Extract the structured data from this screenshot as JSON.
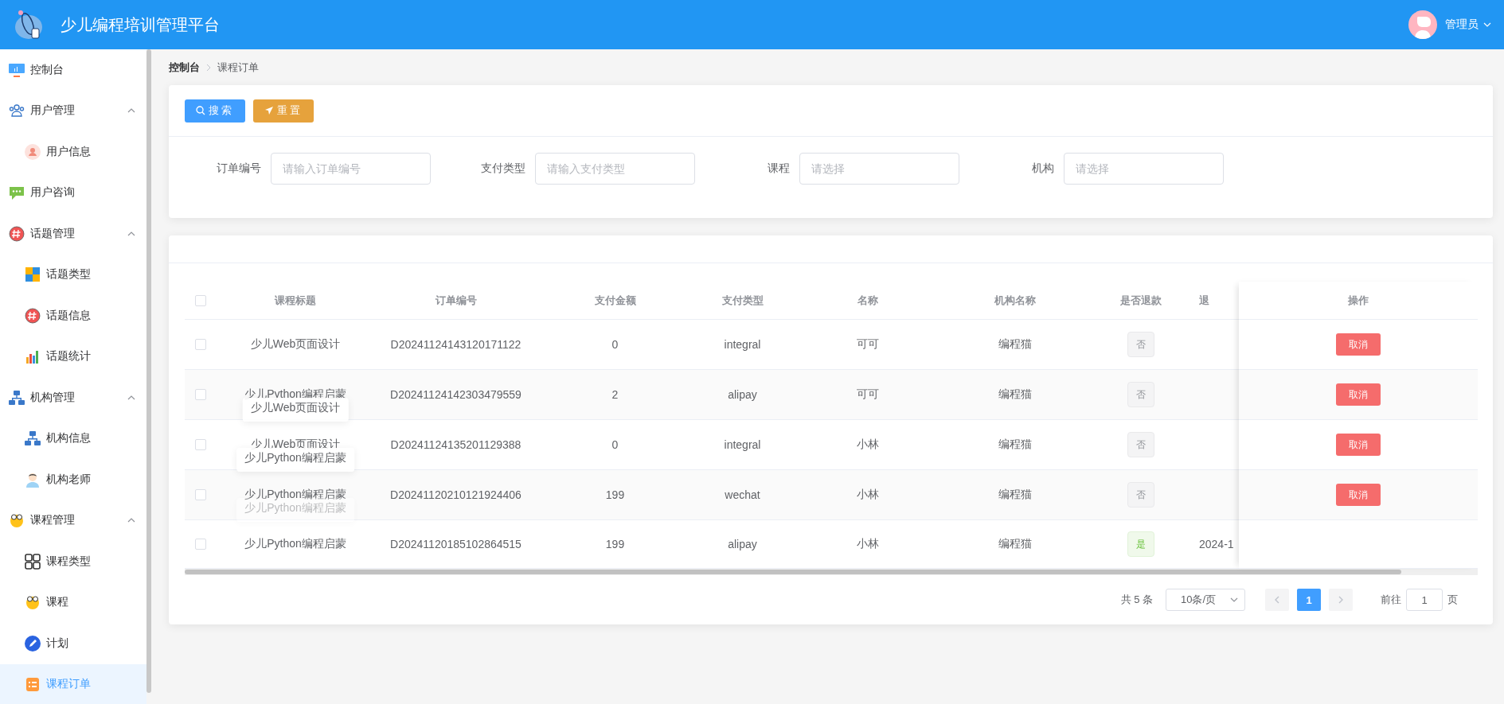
{
  "header": {
    "title": "少儿编程培训管理平台",
    "user": "管理员"
  },
  "sidebar": {
    "items": [
      {
        "label": "控制台",
        "selected": false
      },
      {
        "label": "用户管理",
        "selected": false,
        "expanded": true,
        "children": [
          {
            "label": "用户信息",
            "selected": false
          }
        ]
      },
      {
        "label": "用户咨询",
        "selected": false
      },
      {
        "label": "话题管理",
        "selected": false,
        "expanded": true,
        "children": [
          {
            "label": "话题类型",
            "selected": false
          },
          {
            "label": "话题信息",
            "selected": false
          },
          {
            "label": "话题统计",
            "selected": false
          }
        ]
      },
      {
        "label": "机构管理",
        "selected": false,
        "expanded": true,
        "children": [
          {
            "label": "机构信息",
            "selected": false
          },
          {
            "label": "机构老师",
            "selected": false
          }
        ]
      },
      {
        "label": "课程管理",
        "selected": false,
        "expanded": true,
        "children": [
          {
            "label": "课程类型",
            "selected": false
          },
          {
            "label": "课程",
            "selected": false
          },
          {
            "label": "计划",
            "selected": false
          },
          {
            "label": "课程订单",
            "selected": true
          }
        ]
      }
    ]
  },
  "breadcrumb": [
    "控制台",
    "课程订单"
  ],
  "search": {
    "buttons": [
      {
        "label": "搜索",
        "kind": "search"
      },
      {
        "label": "重置",
        "kind": "reset"
      }
    ],
    "fields": [
      {
        "label": "订单编号",
        "placeholder": "请输入订单编号"
      },
      {
        "label": "支付类型",
        "placeholder": "请输入支付类型"
      },
      {
        "label": "课程",
        "placeholder": "请选择"
      },
      {
        "label": "机构",
        "placeholder": "请选择"
      }
    ]
  },
  "table": {
    "all_checked": false,
    "columns": [
      "课程标题",
      "订单编号",
      "支付金额",
      "支付类型",
      "名称",
      "机构名称",
      "是否退款",
      "退",
      "操作"
    ],
    "rows": [
      {
        "checked": false,
        "title": "少儿Web页面设计",
        "order_no": "D20241124143120171122",
        "amount": "0",
        "pay_type": "integral",
        "name": "可可",
        "org": "编程猫",
        "refund": {
          "text": "否",
          "refunded": false
        },
        "action": "取消"
      },
      {
        "checked": false,
        "title": "少儿Python编程启蒙",
        "order_no": "D20241124142303479559",
        "amount": "2",
        "pay_type": "alipay",
        "name": "可可",
        "org": "编程猫",
        "refund": {
          "text": "否",
          "refunded": false
        },
        "action": "取消",
        "tooltip": {
          "text": "少儿Web页面设计",
          "fading": false
        }
      },
      {
        "checked": false,
        "title": "少儿Web页面设计",
        "order_no": "D20241124135201129388",
        "amount": "0",
        "pay_type": "integral",
        "name": "小林",
        "org": "编程猫",
        "refund": {
          "text": "否",
          "refunded": false
        },
        "action": "取消",
        "tooltip": {
          "text": "少儿Python编程启蒙",
          "fading": false
        }
      },
      {
        "checked": false,
        "title": "少儿Python编程启蒙",
        "order_no": "D20241120210121924406",
        "amount": "199",
        "pay_type": "wechat",
        "name": "小林",
        "org": "编程猫",
        "refund": {
          "text": "否",
          "refunded": false
        },
        "action": "取消",
        "tooltip": {
          "text": "少儿Python编程启蒙",
          "fading": true
        }
      },
      {
        "checked": false,
        "title": "少儿Python编程启蒙",
        "order_no": "D20241120185102864515",
        "amount": "199",
        "pay_type": "alipay",
        "name": "小林",
        "org": "编程猫",
        "refund": {
          "text": "是",
          "refunded": true
        },
        "refund_time": "2024-1"
      }
    ]
  },
  "pagination": {
    "total": "共 5 条",
    "page_size": "10条/页",
    "pages": [
      {
        "label": "1",
        "selected": true
      }
    ],
    "goto_label": "前往",
    "goto_value": "1",
    "page_suffix": "页"
  }
}
